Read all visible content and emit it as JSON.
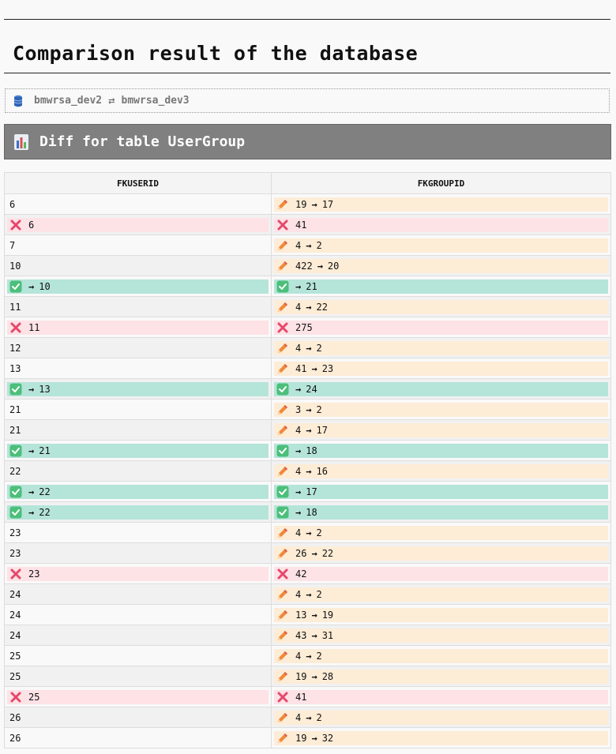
{
  "page": {
    "title": "Comparison result of the database"
  },
  "databases": {
    "source": "bmwrsa_dev2",
    "target": "bmwrsa_dev3",
    "swap_symbol": "⇄",
    "icon": "database-icon"
  },
  "diff": {
    "header": "Diff for table UserGroup",
    "icon": "bar-chart-icon",
    "columns": [
      "FKUSERID",
      "FKGROUPID"
    ],
    "arrow": "→",
    "rows": [
      [
        {
          "type": "plain",
          "value": "6"
        },
        {
          "type": "changed",
          "old": "19",
          "new": "17"
        }
      ],
      [
        {
          "type": "deleted",
          "value": "6"
        },
        {
          "type": "deleted",
          "value": "41"
        }
      ],
      [
        {
          "type": "plain",
          "value": "7"
        },
        {
          "type": "changed",
          "old": "4",
          "new": "2"
        }
      ],
      [
        {
          "type": "plain",
          "value": "10"
        },
        {
          "type": "changed",
          "old": "422",
          "new": "20"
        }
      ],
      [
        {
          "type": "added",
          "value": "10"
        },
        {
          "type": "added",
          "value": "21"
        }
      ],
      [
        {
          "type": "plain",
          "value": "11"
        },
        {
          "type": "changed",
          "old": "4",
          "new": "22"
        }
      ],
      [
        {
          "type": "deleted",
          "value": "11"
        },
        {
          "type": "deleted",
          "value": "275"
        }
      ],
      [
        {
          "type": "plain",
          "value": "12"
        },
        {
          "type": "changed",
          "old": "4",
          "new": "2"
        }
      ],
      [
        {
          "type": "plain",
          "value": "13"
        },
        {
          "type": "changed",
          "old": "41",
          "new": "23"
        }
      ],
      [
        {
          "type": "added",
          "value": "13"
        },
        {
          "type": "added",
          "value": "24"
        }
      ],
      [
        {
          "type": "plain",
          "value": "21"
        },
        {
          "type": "changed",
          "old": "3",
          "new": "2"
        }
      ],
      [
        {
          "type": "plain",
          "value": "21"
        },
        {
          "type": "changed",
          "old": "4",
          "new": "17"
        }
      ],
      [
        {
          "type": "added",
          "value": "21"
        },
        {
          "type": "added",
          "value": "18"
        }
      ],
      [
        {
          "type": "plain",
          "value": "22"
        },
        {
          "type": "changed",
          "old": "4",
          "new": "16"
        }
      ],
      [
        {
          "type": "added",
          "value": "22"
        },
        {
          "type": "added",
          "value": "17"
        }
      ],
      [
        {
          "type": "added",
          "value": "22"
        },
        {
          "type": "added",
          "value": "18"
        }
      ],
      [
        {
          "type": "plain",
          "value": "23"
        },
        {
          "type": "changed",
          "old": "4",
          "new": "2"
        }
      ],
      [
        {
          "type": "plain",
          "value": "23"
        },
        {
          "type": "changed",
          "old": "26",
          "new": "22"
        }
      ],
      [
        {
          "type": "deleted",
          "value": "23"
        },
        {
          "type": "deleted",
          "value": "42"
        }
      ],
      [
        {
          "type": "plain",
          "value": "24"
        },
        {
          "type": "changed",
          "old": "4",
          "new": "2"
        }
      ],
      [
        {
          "type": "plain",
          "value": "24"
        },
        {
          "type": "changed",
          "old": "13",
          "new": "19"
        }
      ],
      [
        {
          "type": "plain",
          "value": "24"
        },
        {
          "type": "changed",
          "old": "43",
          "new": "31"
        }
      ],
      [
        {
          "type": "plain",
          "value": "25"
        },
        {
          "type": "changed",
          "old": "4",
          "new": "2"
        }
      ],
      [
        {
          "type": "plain",
          "value": "25"
        },
        {
          "type": "changed",
          "old": "19",
          "new": "28"
        }
      ],
      [
        {
          "type": "deleted",
          "value": "25"
        },
        {
          "type": "deleted",
          "value": "41"
        }
      ],
      [
        {
          "type": "plain",
          "value": "26"
        },
        {
          "type": "changed",
          "old": "4",
          "new": "2"
        }
      ],
      [
        {
          "type": "plain",
          "value": "26"
        },
        {
          "type": "changed",
          "old": "19",
          "new": "32"
        }
      ]
    ]
  },
  "colors": {
    "changed": "#fdecd6",
    "deleted": "#fde2e6",
    "added": "#b5e4d9",
    "header_bg": "#808080"
  }
}
